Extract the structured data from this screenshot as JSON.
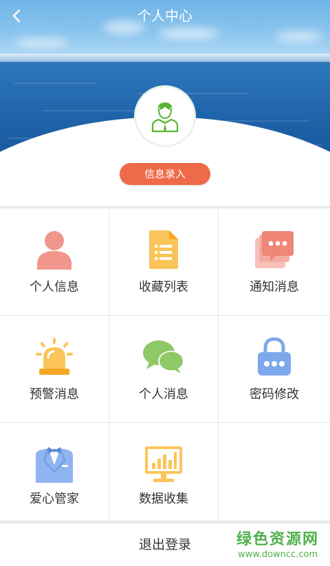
{
  "header": {
    "title": "个人中心",
    "back_icon": "chevron-left-icon"
  },
  "profile": {
    "avatar_icon": "user-avatar-icon",
    "info_button_label": "信息录入"
  },
  "menu": {
    "items": [
      {
        "label": "个人信息",
        "icon": "person-icon",
        "color": "#f0968c"
      },
      {
        "label": "收藏列表",
        "icon": "document-list-icon",
        "color": "#fbc45a"
      },
      {
        "label": "通知消息",
        "icon": "notification-cards-icon",
        "color": "#f29a8e"
      },
      {
        "label": "预警消息",
        "icon": "alarm-light-icon",
        "color": "#fbc45a"
      },
      {
        "label": "个人消息",
        "icon": "chat-bubbles-icon",
        "color": "#8fc866"
      },
      {
        "label": "密码修改",
        "icon": "padlock-icon",
        "color": "#7ea8ec"
      },
      {
        "label": "爱心管家",
        "icon": "butler-icon",
        "color": "#8fb4ef"
      },
      {
        "label": "数据收集",
        "icon": "monitor-chart-icon",
        "color": "#fbc45a"
      }
    ]
  },
  "footer": {
    "logout_label": "退出登录"
  },
  "watermark": {
    "brand": "绿色资源网",
    "url": "www.downcc.com"
  },
  "colors": {
    "accent": "#ee6a48",
    "watermark": "#4fb04a"
  }
}
